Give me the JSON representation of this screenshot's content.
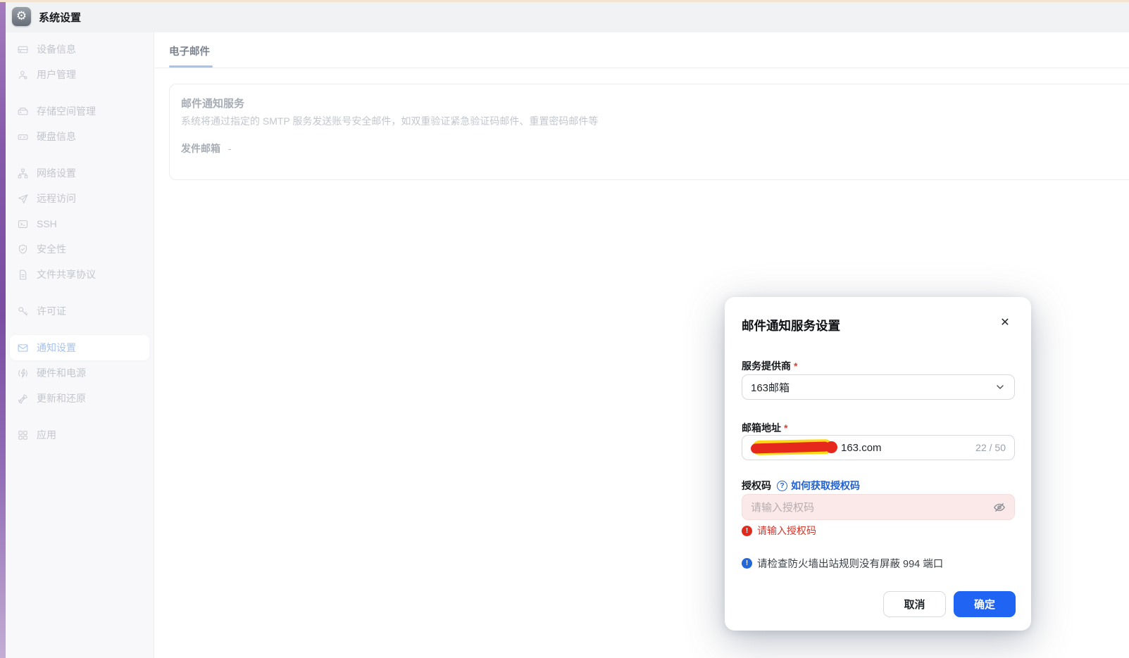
{
  "topbar": {
    "app_title": "系统设置",
    "app_icon": "gear-icon"
  },
  "sidebar": {
    "groups": [
      {
        "items": [
          {
            "label": "设备信息",
            "icon": "device-info-icon"
          },
          {
            "label": "用户管理",
            "icon": "users-icon"
          }
        ]
      },
      {
        "items": [
          {
            "label": "存储空间管理",
            "icon": "storage-icon"
          },
          {
            "label": "硬盘信息",
            "icon": "disk-icon"
          }
        ]
      },
      {
        "items": [
          {
            "label": "网络设置",
            "icon": "network-icon"
          },
          {
            "label": "远程访问",
            "icon": "remote-access-icon"
          },
          {
            "label": "SSH",
            "icon": "terminal-icon"
          },
          {
            "label": "安全性",
            "icon": "shield-icon"
          },
          {
            "label": "文件共享协议",
            "icon": "file-share-icon"
          }
        ]
      },
      {
        "items": [
          {
            "label": "许可证",
            "icon": "key-icon"
          }
        ]
      },
      {
        "items": [
          {
            "label": "通知设置",
            "icon": "mail-icon",
            "active": true
          },
          {
            "label": "硬件和电源",
            "icon": "power-icon"
          },
          {
            "label": "更新和还原",
            "icon": "rocket-icon"
          }
        ]
      },
      {
        "items": [
          {
            "label": "应用",
            "icon": "apps-icon"
          }
        ]
      }
    ]
  },
  "main": {
    "tab": "电子邮件",
    "card": {
      "title": "邮件通知服务",
      "description": "系统将通过指定的 SMTP 服务发送账号安全邮件，如双重验证紧急验证码邮件、重置密码邮件等",
      "sender_label": "发件邮箱",
      "sender_value": "-"
    }
  },
  "modal": {
    "title": "邮件通知服务设置",
    "close_glyph": "✕",
    "required_mark": "*",
    "provider": {
      "label": "服务提供商",
      "value": "163邮箱"
    },
    "email": {
      "label": "邮箱地址",
      "visible_value": "163.com",
      "redacted": true,
      "counter": "22 / 50"
    },
    "auth_code": {
      "label": "授权码",
      "help_glyph": "?",
      "help_link": "如何获取授权码",
      "placeholder": "请输入授权码",
      "error": "请输入授权码",
      "alert_glyph": "!"
    },
    "info_note": "请检查防火墙出站规则没有屏蔽 994 端口",
    "cancel_label": "取消",
    "ok_label": "确定"
  },
  "colors": {
    "primary_blue": "#1f64f2",
    "link_blue": "#2161d3",
    "error_red": "#d8352b",
    "accent_purple": "#7a4da2",
    "active_item_blue": "#a6c3ee"
  }
}
